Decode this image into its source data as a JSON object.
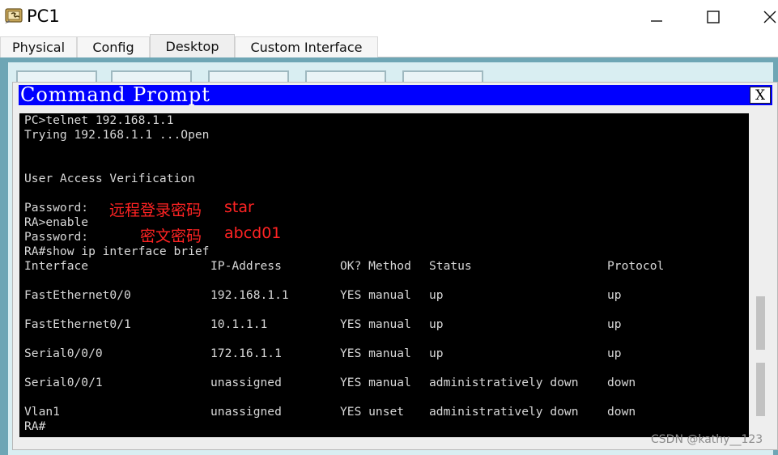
{
  "window": {
    "title": "PC1",
    "icon": "packet-tracer-pc-icon",
    "controls": [
      "minimize-icon",
      "maximize-icon",
      "close-icon"
    ]
  },
  "tabs": [
    {
      "label": "Physical",
      "active": false
    },
    {
      "label": "Config",
      "active": false
    },
    {
      "label": "Desktop",
      "active": true
    },
    {
      "label": "Custom Interface",
      "active": false
    }
  ],
  "command_prompt": {
    "title": "Command Prompt",
    "close_label": "X",
    "lines": [
      "PC>telnet 192.168.1.1",
      "Trying 192.168.1.1 ...Open",
      "",
      "",
      "User Access Verification",
      "",
      "Password:",
      "RA>enable",
      "Password:",
      "RA#show ip interface brief"
    ],
    "table": {
      "headers": [
        "Interface",
        "IP-Address",
        "OK? Method",
        "Status",
        "Protocol"
      ],
      "rows": [
        [
          "FastEthernet0/0",
          "192.168.1.1",
          "YES manual",
          "up",
          "up"
        ],
        [
          "FastEthernet0/1",
          "10.1.1.1",
          "YES manual",
          "up",
          "up"
        ],
        [
          "Serial0/0/0",
          "172.16.1.1",
          "YES manual",
          "up",
          "up"
        ],
        [
          "Serial0/0/1",
          "unassigned",
          "YES manual",
          "administratively down",
          "down"
        ],
        [
          "Vlan1",
          "unassigned",
          "YES unset",
          "administratively down",
          "down"
        ]
      ]
    },
    "prompt": "RA#"
  },
  "annotations": {
    "remote_password_label": "远程登录密码",
    "remote_password_value": "star",
    "secret_label": "密文密码",
    "secret_value": "abcd01",
    "color": "#ff2323"
  },
  "watermark": "CSDN @kathy__123",
  "colors": {
    "desktop_bg": "#6ea6b5",
    "cmd_titlebar": "#0000ff",
    "terminal_bg": "#000000",
    "terminal_text": "#d8d8d8"
  }
}
